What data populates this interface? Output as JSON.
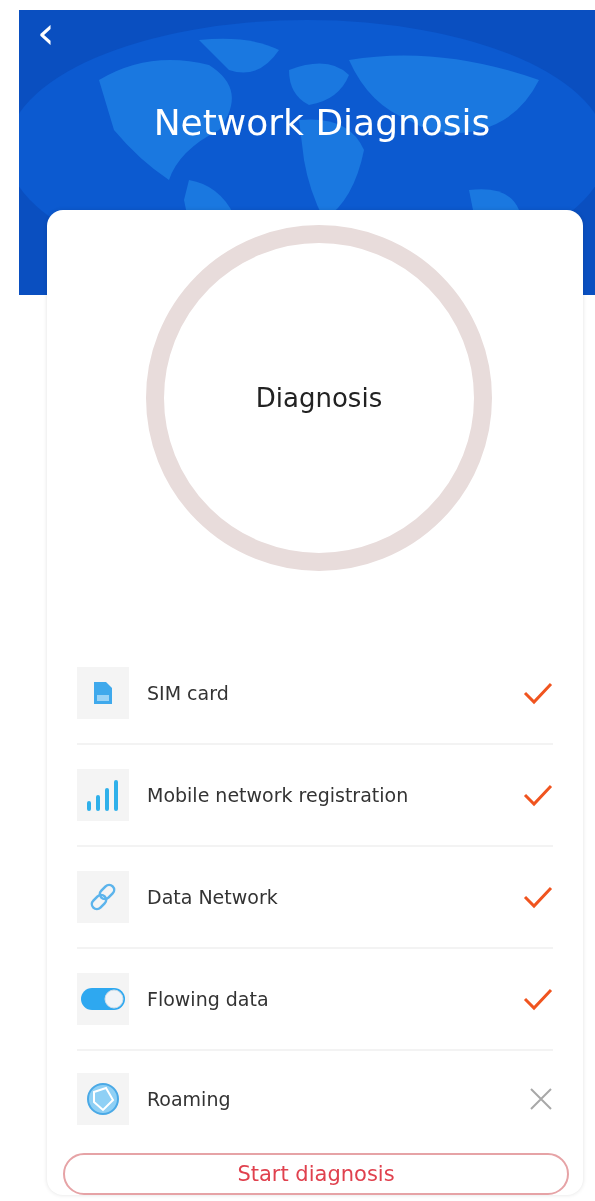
{
  "header": {
    "back": "‹",
    "title": "Network Diagnosis"
  },
  "dial": {
    "label": "Diagnosis"
  },
  "checks": [
    {
      "kind": "sim",
      "label": "SIM card",
      "passed": true
    },
    {
      "kind": "signal",
      "label": "Mobile network registration",
      "passed": true
    },
    {
      "kind": "link",
      "label": "Data Network",
      "passed": true
    },
    {
      "kind": "toggle",
      "label": "Flowing data",
      "passed": true
    },
    {
      "kind": "globe",
      "label": "Roaming",
      "passed": false
    }
  ],
  "button": {
    "label": "Start diagnosis"
  }
}
